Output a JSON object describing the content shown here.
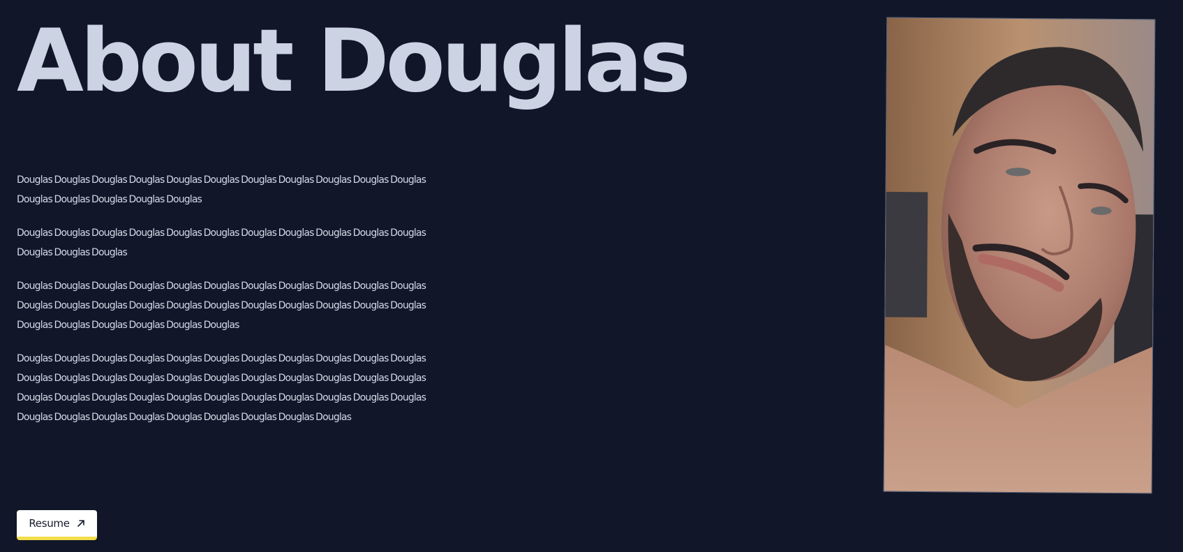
{
  "heading": {
    "title": "About Douglas"
  },
  "bio": {
    "paragraphs": [
      "Douglas Douglas Douglas Douglas Douglas Douglas Douglas Douglas Douglas Douglas Douglas Douglas Douglas Douglas Douglas Douglas",
      "Douglas Douglas Douglas Douglas Douglas Douglas Douglas Douglas Douglas Douglas Douglas Douglas Douglas Douglas",
      "Douglas Douglas Douglas Douglas Douglas Douglas Douglas Douglas Douglas Douglas Douglas Douglas Douglas Douglas Douglas Douglas Douglas Douglas Douglas Douglas Douglas Douglas Douglas Douglas Douglas Douglas Douglas Douglas",
      "Douglas Douglas Douglas Douglas Douglas Douglas Douglas Douglas Douglas Douglas Douglas Douglas Douglas Douglas Douglas Douglas Douglas Douglas Douglas Douglas Douglas Douglas Douglas Douglas Douglas Douglas Douglas Douglas Douglas Douglas Douglas Douglas Douglas Douglas Douglas Douglas Douglas Douglas Douglas Douglas Douglas Douglas"
    ]
  },
  "resume_button": {
    "label": "Resume",
    "icon": "arrow-up-right-icon"
  },
  "portrait": {
    "icon": "portrait-photo"
  },
  "colors": {
    "background": "#111729",
    "title": "#ccd3e3",
    "text": "#d4d9e6",
    "button_bg": "#ffffff",
    "button_accent": "#f2dd4b",
    "frame_border": "#5c6580"
  }
}
